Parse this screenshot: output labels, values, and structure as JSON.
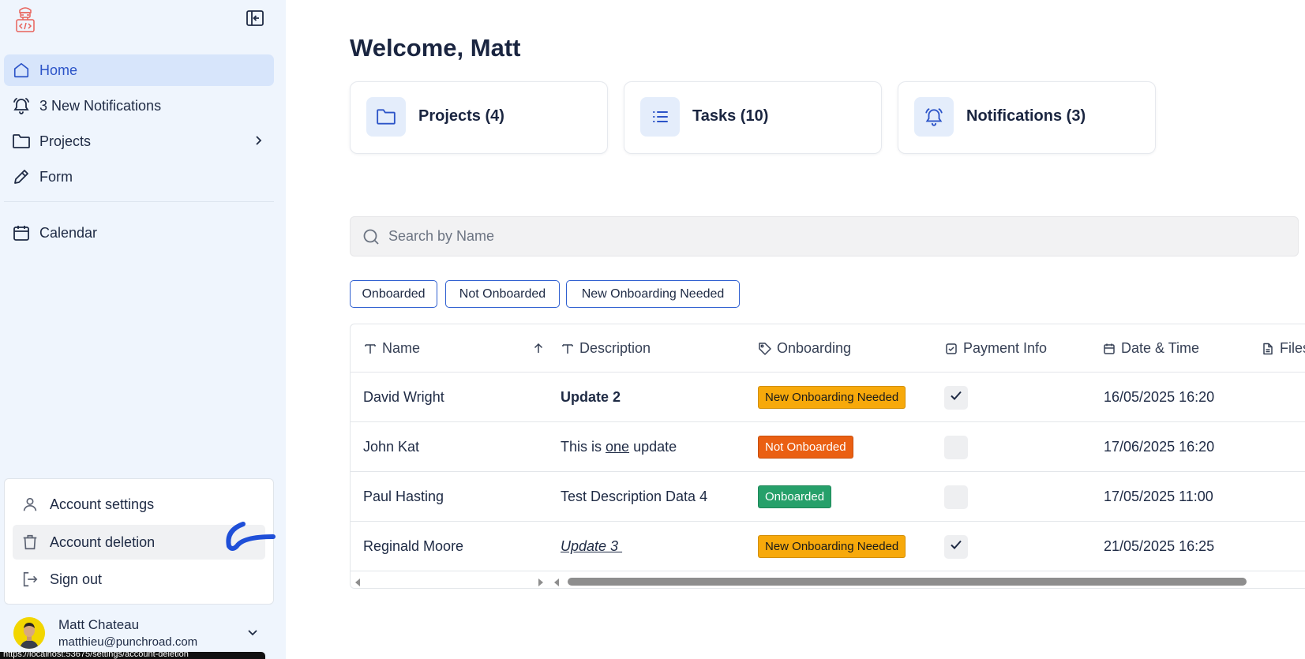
{
  "brand": {
    "logo_icon": "developer-mascot-icon",
    "accent": "#2c54c8",
    "logo_color": "#e8625b"
  },
  "sidebar": {
    "collapse_icon": "sidebar-collapse-icon",
    "items": [
      {
        "label": "Home",
        "icon": "home-icon",
        "active": true
      },
      {
        "label": "3 New Notifications",
        "icon": "bell-ringing-icon"
      },
      {
        "label": "Projects",
        "icon": "folder-icon",
        "has_submenu": true
      },
      {
        "label": "Form",
        "icon": "pen-icon"
      },
      {
        "label": "Calendar",
        "icon": "calendar-icon"
      }
    ],
    "account_menu": [
      {
        "label": "Account settings",
        "icon": "user-icon"
      },
      {
        "label": "Account deletion",
        "icon": "trash-icon"
      },
      {
        "label": "Sign out",
        "icon": "sign-out-icon"
      }
    ],
    "user": {
      "name": "Matt Chateau",
      "email": "matthieu@punchroad.com"
    },
    "status_url": "https://localhost:53675/settings/account-deletion"
  },
  "main": {
    "welcome": "Welcome, Matt",
    "cards": [
      {
        "label": "Projects (4)",
        "icon": "folder-icon"
      },
      {
        "label": "Tasks (10)",
        "icon": "list-icon"
      },
      {
        "label": "Notifications (3)",
        "icon": "bell-ringing-icon"
      }
    ],
    "search": {
      "placeholder": "Search by Name",
      "value": ""
    },
    "filters": [
      "Onboarded",
      "Not Onboarded",
      "New Onboarding Needed"
    ],
    "table": {
      "columns": [
        {
          "label": "Name",
          "icon": "text-type-icon",
          "sort": "ascending"
        },
        {
          "label": "Description",
          "icon": "text-type-icon"
        },
        {
          "label": "Onboarding",
          "icon": "tag-icon"
        },
        {
          "label": "Payment Info",
          "icon": "checkbox-icon"
        },
        {
          "label": "Date & Time",
          "icon": "calendar-icon"
        },
        {
          "label": "Files",
          "icon": "file-icon"
        }
      ],
      "rows": [
        {
          "name": "David Wright",
          "description": "Update 2",
          "desc_style": "bold",
          "onboarding": "New Onboarding Needed",
          "payment": true,
          "datetime": "16/05/2025 16:20"
        },
        {
          "name": "John Kat",
          "description": {
            "before": "This is ",
            "underlined": "one",
            "after": " update"
          },
          "desc_style": "mixed",
          "onboarding": "Not Onboarded",
          "payment": false,
          "datetime": "17/06/2025 16:20"
        },
        {
          "name": "Paul Hasting",
          "description": "Test Description Data 4",
          "desc_style": "normal",
          "onboarding": "Onboarded",
          "payment": false,
          "datetime": "17/05/2025 11:00"
        },
        {
          "name": "Reginald Moore",
          "description": "Update 3 ",
          "desc_style": "italic-underline",
          "onboarding": "New Onboarding Needed",
          "payment": true,
          "datetime": "21/05/2025 16:25"
        }
      ],
      "status_colors": {
        "New Onboarding Needed": {
          "bg": "#f7a90b",
          "fg": "#1a1a1a"
        },
        "Not Onboarded": {
          "bg": "#ea5f12",
          "fg": "#ffffff"
        },
        "Onboarded": {
          "bg": "#26a06a",
          "fg": "#ffffff"
        }
      }
    }
  }
}
